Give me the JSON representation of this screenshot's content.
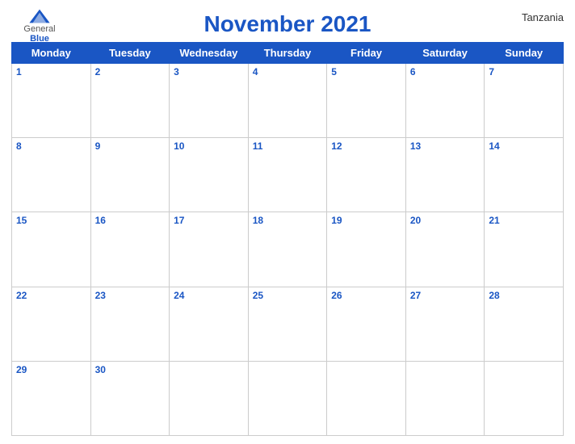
{
  "header": {
    "logo": {
      "general": "General",
      "blue": "Blue"
    },
    "title": "November 2021",
    "country": "Tanzania"
  },
  "calendar": {
    "days_of_week": [
      "Monday",
      "Tuesday",
      "Wednesday",
      "Thursday",
      "Friday",
      "Saturday",
      "Sunday"
    ],
    "weeks": [
      [
        1,
        2,
        3,
        4,
        5,
        6,
        7
      ],
      [
        8,
        9,
        10,
        11,
        12,
        13,
        14
      ],
      [
        15,
        16,
        17,
        18,
        19,
        20,
        21
      ],
      [
        22,
        23,
        24,
        25,
        26,
        27,
        28
      ],
      [
        29,
        30,
        null,
        null,
        null,
        null,
        null
      ]
    ]
  },
  "colors": {
    "primary": "#1a56c4",
    "header_text": "#ffffff",
    "cell_bg": "#ffffff",
    "border": "#cccccc"
  }
}
